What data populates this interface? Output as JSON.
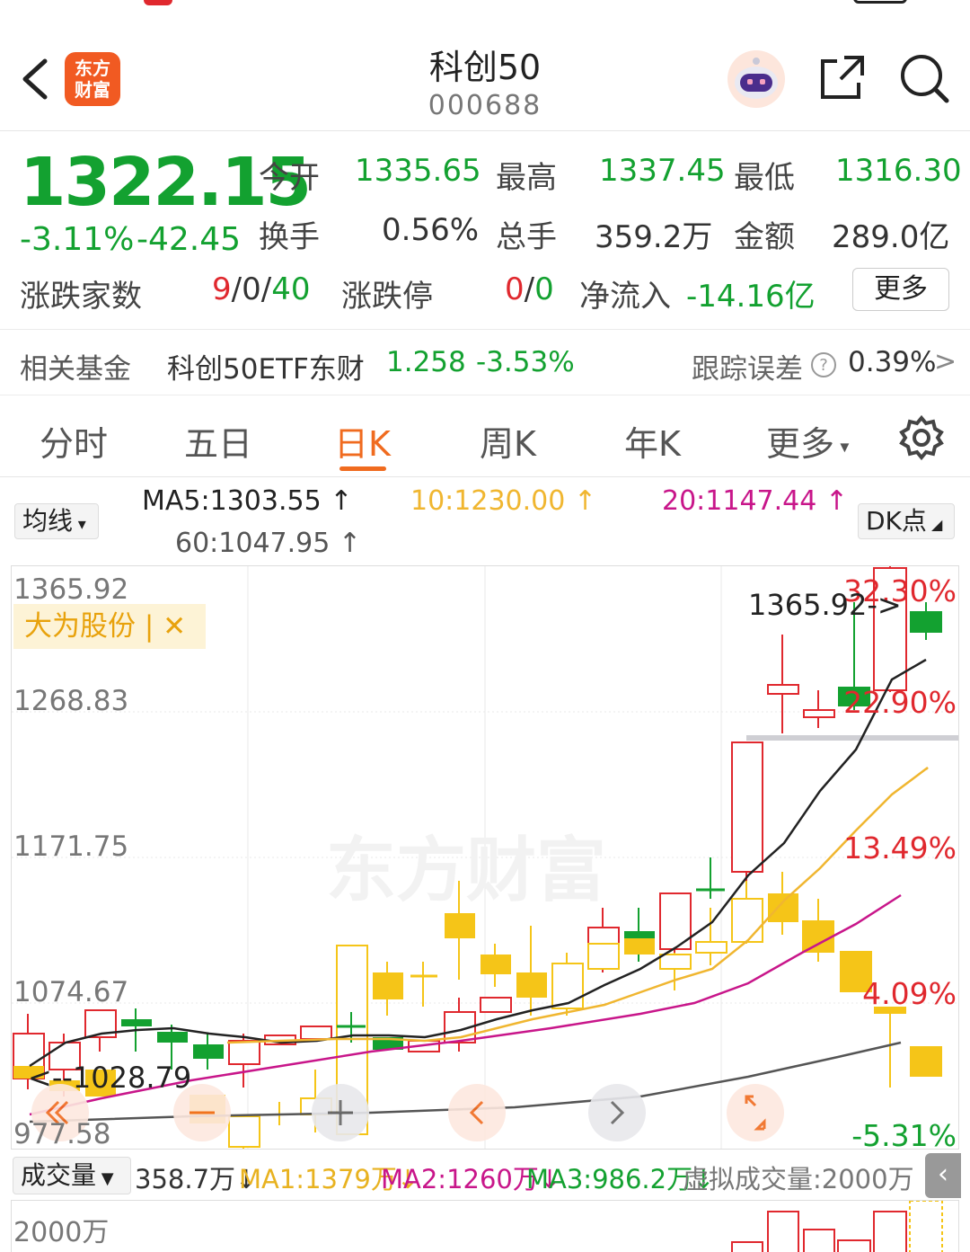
{
  "header": {
    "app_logo_text_1": "东方",
    "app_logo_text_2": "财富",
    "title": "科创50",
    "code": "000688"
  },
  "quote": {
    "price": "1322.15",
    "change_pct": "-3.11%",
    "change": "-42.45",
    "open_label": "今开",
    "open": "1335.65",
    "high_label": "最高",
    "high": "1337.45",
    "low_label": "最低",
    "low": "1316.30",
    "turnover_label": "换手",
    "turnover": "0.56%",
    "volume_label": "总手",
    "volume": "359.2万",
    "amount_label": "金额",
    "amount": "289.0亿",
    "breadth_label": "涨跌家数",
    "breadth_up": "9",
    "breadth_sep1": "/",
    "breadth_flat": "0",
    "breadth_sep2": "/",
    "breadth_down": "40",
    "limit_label": "涨跌停",
    "limit_up": "0",
    "limit_sep": "/",
    "limit_down": "0",
    "netflow_label": "净流入",
    "netflow": "-14.16亿",
    "more_label": "更多"
  },
  "fund": {
    "label": "相关基金",
    "name": "科创50ETF东财",
    "price": "1.258",
    "change": "-3.53%",
    "tracking_label": "跟踪误差",
    "tracking_value": "0.39%",
    "arrow": ">"
  },
  "tabs": [
    {
      "label": "分时"
    },
    {
      "label": "五日"
    },
    {
      "label": "日K"
    },
    {
      "label": "周K"
    },
    {
      "label": "年K"
    },
    {
      "label": "更多"
    }
  ],
  "ma": {
    "selector": "均线",
    "ma5": "MA5:1303.55",
    "ma10": "10:1230.00",
    "ma20": "20:1147.44",
    "ma60": "60:1047.95",
    "dk_label": "DK点"
  },
  "colors": {
    "up": "#e0282e",
    "down": "#13a130",
    "accent": "#f06b1f",
    "ma5": "#222222",
    "ma10": "#f0b630",
    "ma20": "#c8168a",
    "ma60": "#555555"
  },
  "chart": {
    "y_labels": [
      "1365.92",
      "1268.83",
      "1171.75",
      "1074.67",
      "977.58"
    ],
    "pct_labels": [
      "32.30%",
      "22.90%",
      "13.49%",
      "4.09%",
      "-5.31%"
    ],
    "max_marker": "1365.92->",
    "min_marker": "<--1028.79",
    "stock_tag": "大为股份",
    "stock_tag_sep": "|",
    "stock_tag_close": "✕",
    "watermark": "东方财富"
  },
  "volume": {
    "selector": "成交量",
    "current": "358.7万",
    "ma1": "MA1:1379万",
    "ma2": "MA2:1260万",
    "ma3": "MA3:986.2万",
    "virtual": "虚拟成交量:2000万",
    "axis_top": "2000万"
  }
}
